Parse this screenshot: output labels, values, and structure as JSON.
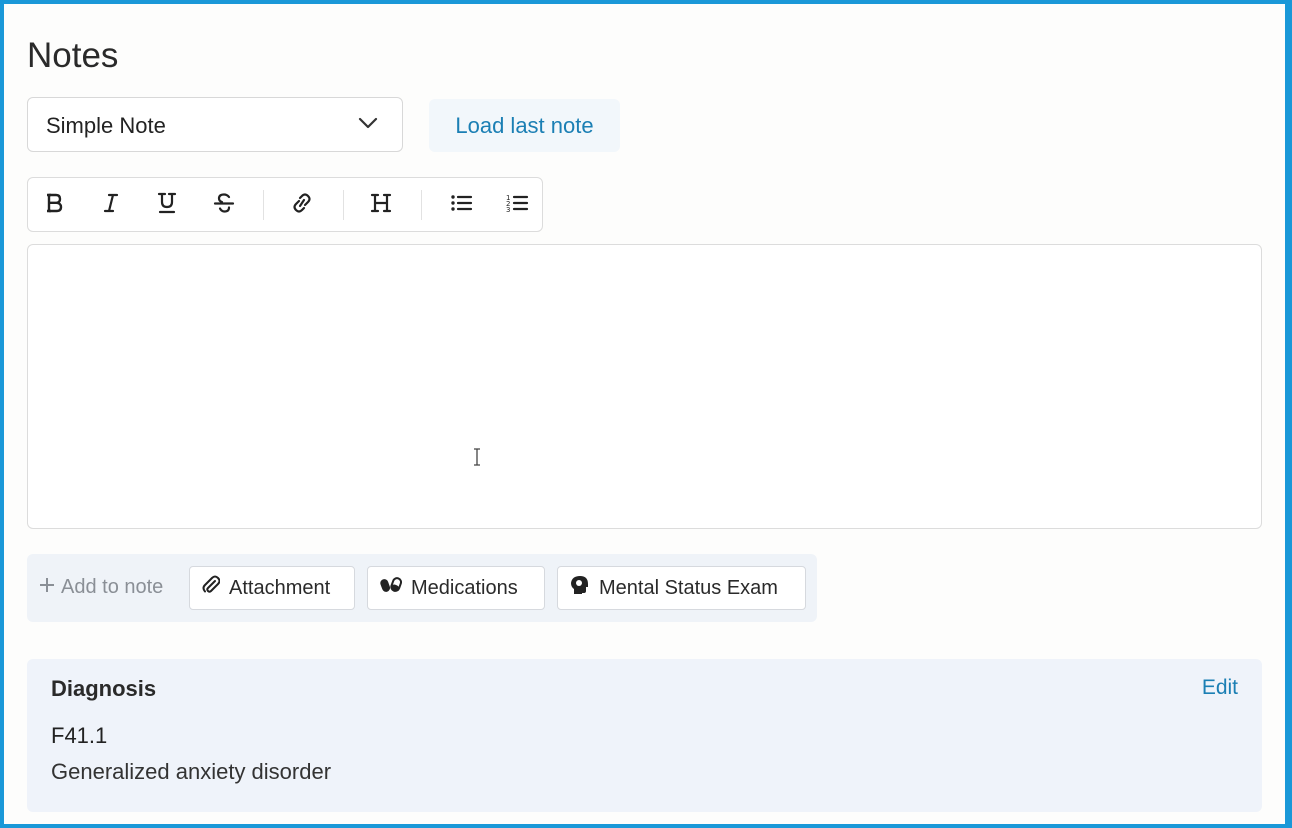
{
  "notes": {
    "title": "Notes",
    "template_select": {
      "selected": "Simple Note"
    },
    "load_last_note_label": "Load last note",
    "toolbar": {
      "buttons": [
        {
          "name": "bold",
          "icon": "bold-icon"
        },
        {
          "name": "italic",
          "icon": "italic-icon"
        },
        {
          "name": "underline",
          "icon": "underline-icon"
        },
        {
          "name": "strikethrough",
          "icon": "strikethrough-icon"
        },
        {
          "name": "link",
          "icon": "link-icon"
        },
        {
          "name": "heading",
          "icon": "heading-icon"
        },
        {
          "name": "bullet-list",
          "icon": "bullet-list-icon"
        },
        {
          "name": "numbered-list",
          "icon": "numbered-list-icon"
        }
      ]
    },
    "editor": {
      "value": ""
    },
    "add_to_note": {
      "label": "Add to note",
      "items": [
        {
          "label": "Attachment",
          "icon": "paperclip-icon"
        },
        {
          "label": "Medications",
          "icon": "pills-icon"
        },
        {
          "label": "Mental Status Exam",
          "icon": "brain-head-icon"
        }
      ]
    }
  },
  "diagnosis": {
    "title": "Diagnosis",
    "edit_label": "Edit",
    "code": "F41.1",
    "description": "Generalized anxiety disorder"
  },
  "colors": {
    "frame_border": "#1a98d8",
    "link": "#1b7fb4",
    "panel_bg": "#eff3fa"
  }
}
